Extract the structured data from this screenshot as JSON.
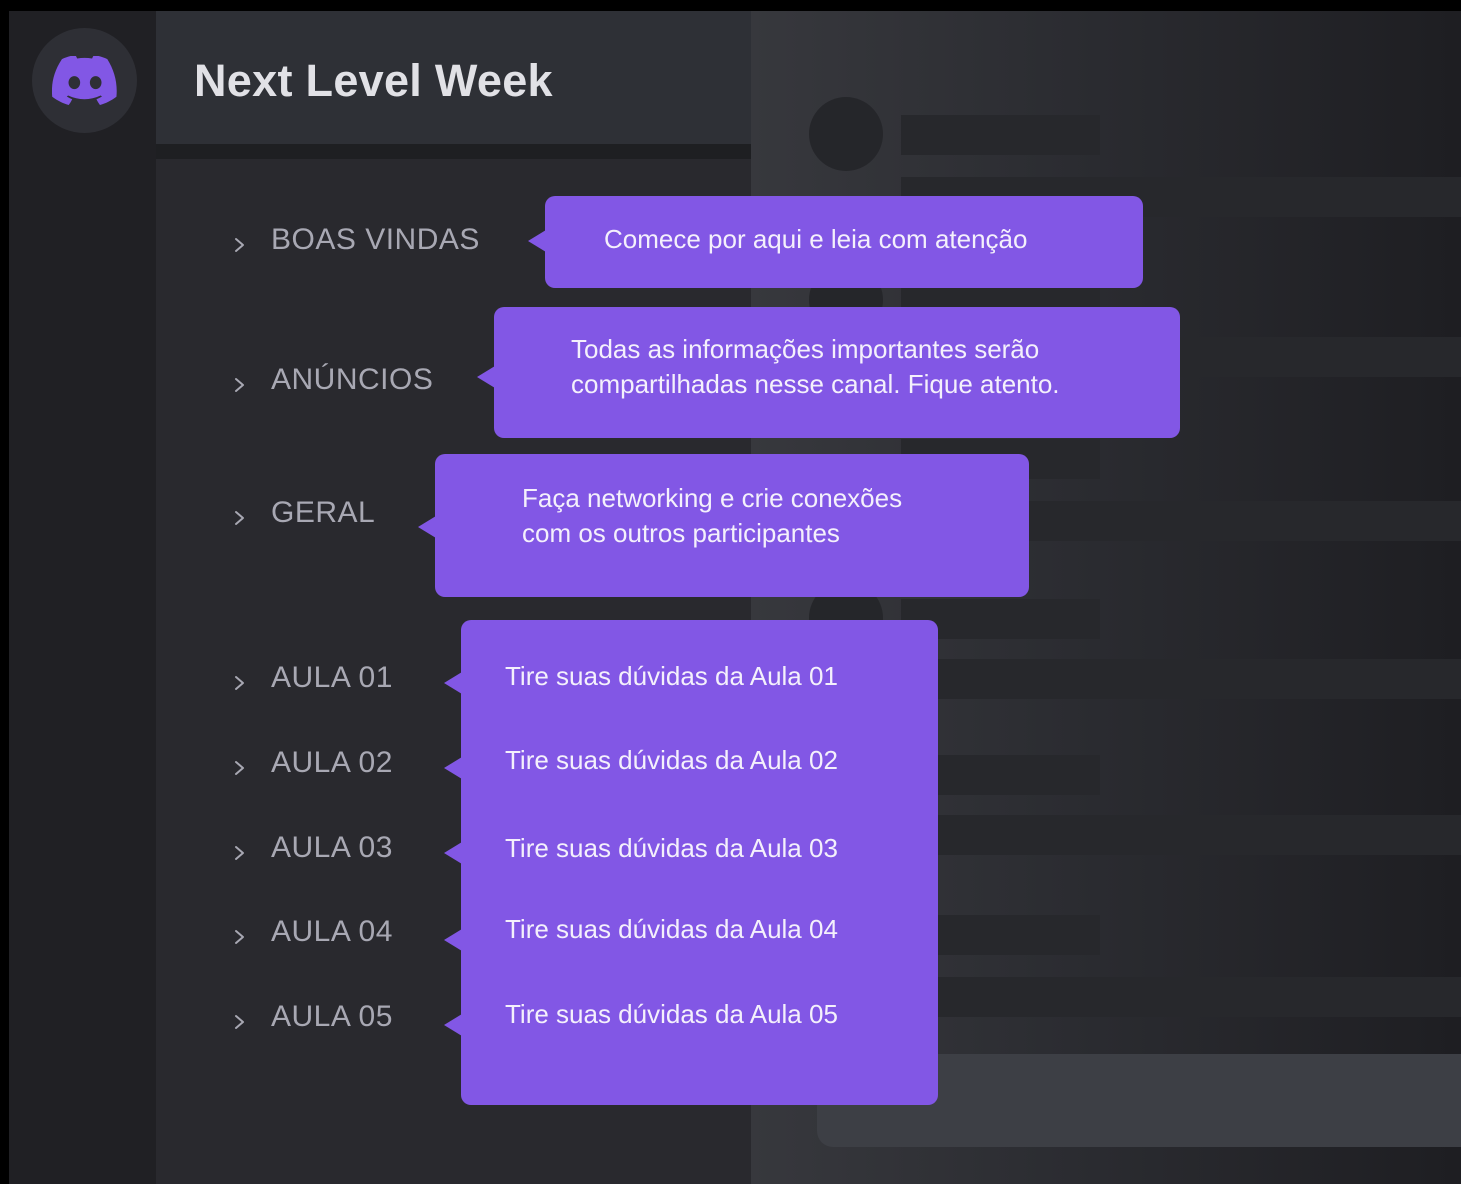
{
  "server": {
    "title": "Next Level Week",
    "icon": "discord-logo-icon",
    "accent_color": "#8257e5"
  },
  "channels": [
    {
      "label": "BOAS VINDAS",
      "icon": "chevron-right-icon"
    },
    {
      "label": "ANÚNCIOS",
      "icon": "chevron-right-icon"
    },
    {
      "label": "GERAL",
      "icon": "chevron-right-icon"
    },
    {
      "label": "AULA 01",
      "icon": "chevron-right-icon"
    },
    {
      "label": "AULA 02",
      "icon": "chevron-right-icon"
    },
    {
      "label": "AULA 03",
      "icon": "chevron-right-icon"
    },
    {
      "label": "AULA 04",
      "icon": "chevron-right-icon"
    },
    {
      "label": "AULA 05",
      "icon": "chevron-right-icon"
    }
  ],
  "tooltips": {
    "boas_vindas": "Comece por aqui e leia com atenção",
    "anuncios": [
      "Todas as informações importantes serão",
      "compartilhadas nesse canal. Fique atento."
    ],
    "geral": [
      "Faça networking e crie conexões",
      "com os outros participantes"
    ],
    "aulas": [
      "Tire suas dúvidas da Aula 01",
      "Tire suas dúvidas da Aula 02",
      "Tire suas dúvidas da Aula 03",
      "Tire suas dúvidas da Aula 04",
      "Tire suas dúvidas da Aula 05"
    ]
  }
}
